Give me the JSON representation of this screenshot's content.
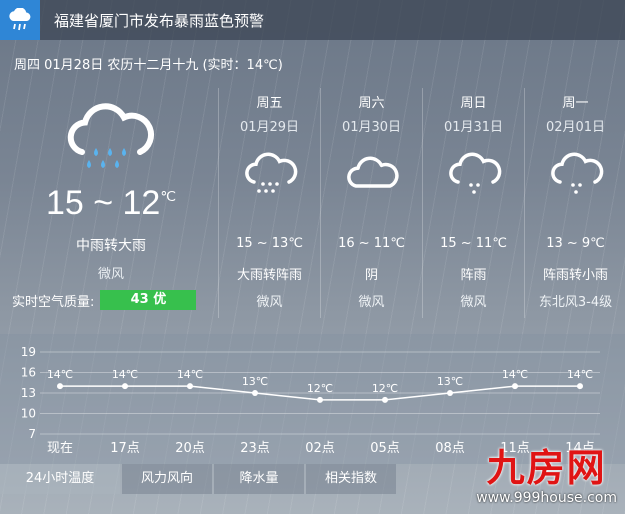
{
  "warning": {
    "title": "福建省厦门市发布暴雨蓝色预警",
    "icon": "rain-warning-icon"
  },
  "date_line": "周四 01月28日 农历十二月十九 (实时：14℃)",
  "today": {
    "icon": "cloud-rain-icon",
    "temp": "15 ~ 12",
    "unit": "℃",
    "condition": "中雨转大雨",
    "wind": "微风",
    "aq_label": "实时空气质量:",
    "aq_value": "43 优"
  },
  "forecast": [
    {
      "name": "周五",
      "date": "01月29日",
      "temp": "15 ~ 13℃",
      "condition": "大雨转阵雨",
      "wind": "微风",
      "icon": "cloud-rain-icon"
    },
    {
      "name": "周六",
      "date": "01月30日",
      "temp": "16 ~ 11℃",
      "condition": "阴",
      "wind": "微风",
      "icon": "cloud-icon"
    },
    {
      "name": "周日",
      "date": "01月31日",
      "temp": "15 ~ 11℃",
      "condition": "阵雨",
      "wind": "微风",
      "icon": "cloud-shower-icon"
    },
    {
      "name": "周一",
      "date": "02月01日",
      "temp": "13 ~ 9℃",
      "condition": "阵雨转小雨",
      "wind": "东北风3-4级",
      "icon": "cloud-shower-icon"
    }
  ],
  "chart_data": {
    "type": "line",
    "categories": [
      "现在",
      "17点",
      "20点",
      "23点",
      "02点",
      "05点",
      "08点",
      "11点",
      "14点"
    ],
    "values": [
      14,
      14,
      14,
      13,
      12,
      12,
      13,
      14,
      14
    ],
    "point_labels": [
      "14℃",
      "14℃",
      "14℃",
      "13℃",
      "12℃",
      "12℃",
      "13℃",
      "14℃",
      "14℃"
    ],
    "yticks": [
      "19",
      "16",
      "13",
      "10",
      "7"
    ],
    "ylim": [
      7,
      19
    ],
    "grid": true
  },
  "tabs": [
    "24小时温度",
    "风力风向",
    "降水量",
    "相关指数"
  ],
  "brand": {
    "logo": "九房网",
    "url": "www.999house.com"
  }
}
